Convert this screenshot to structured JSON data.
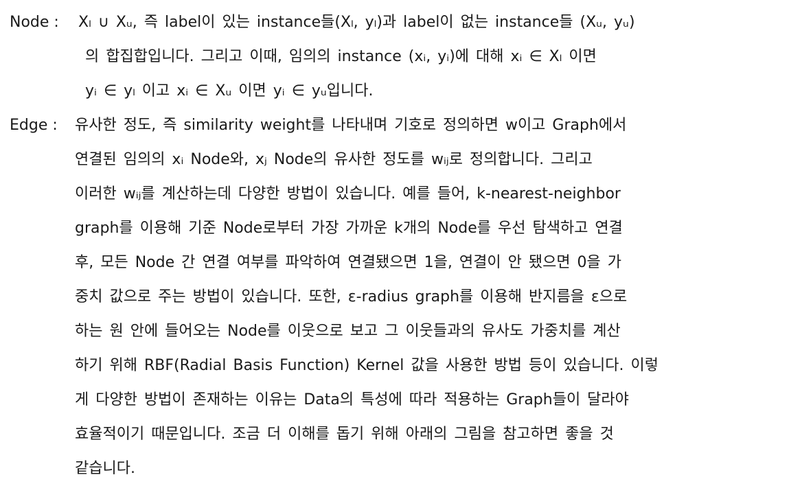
{
  "node": {
    "term": "Node :",
    "lines": [
      "Xₗ ∪ Xᵤ, 즉 label이 있는 instance들(Xₗ, yₗ)과 label이 없는 instance들 (Xᵤ, yᵤ)",
      "의 합집합입니다. 그리고 이때, 임의의 instance (xᵢ, yᵢ)에 대해 xᵢ ∈ Xₗ 이면",
      "yᵢ ∈ yₗ 이고 xᵢ ∈ Xᵤ 이면 yᵢ ∈ yᵤ입니다."
    ]
  },
  "edge": {
    "term": "Edge :",
    "lines": [
      "유사한 정도, 즉 similarity weight를 나타내며 기호로 정의하면 w이고 Graph에서",
      "연결된 임의의 xᵢ Node와, xⱼ Node의 유사한 정도를 wᵢⱼ로 정의합니다. 그리고",
      "이러한 wᵢⱼ를 계산하는데 다양한 방법이 있습니다. 예를 들어, k-nearest-neighbor",
      "graph를 이용해 기준 Node로부터 가장 가까운 k개의 Node를 우선 탐색하고 연결",
      "후, 모든 Node 간 연결 여부를 파악하여 연결됐으면 1을, 연결이 안 됐으면 0을 가",
      "중치 값으로 주는 방법이 있습니다. 또한, ε-radius graph를 이용해 반지름을 ε으로",
      "하는 원 안에 들어오는 Node를 이웃으로 보고 그 이웃들과의 유사도 가중치를 계산",
      "하기 위해 RBF(Radial Basis Function) Kernel 값을 사용한 방법 등이 있습니다. 이렇",
      "게 다양한 방법이 존재하는 이유는 Data의 특성에 따라 적용하는 Graph들이 달라야",
      "효율적이기 때문입니다. 조금 더 이해를 돕기 위해 아래의 그림을 참고하면 좋을 것",
      "같습니다."
    ]
  }
}
